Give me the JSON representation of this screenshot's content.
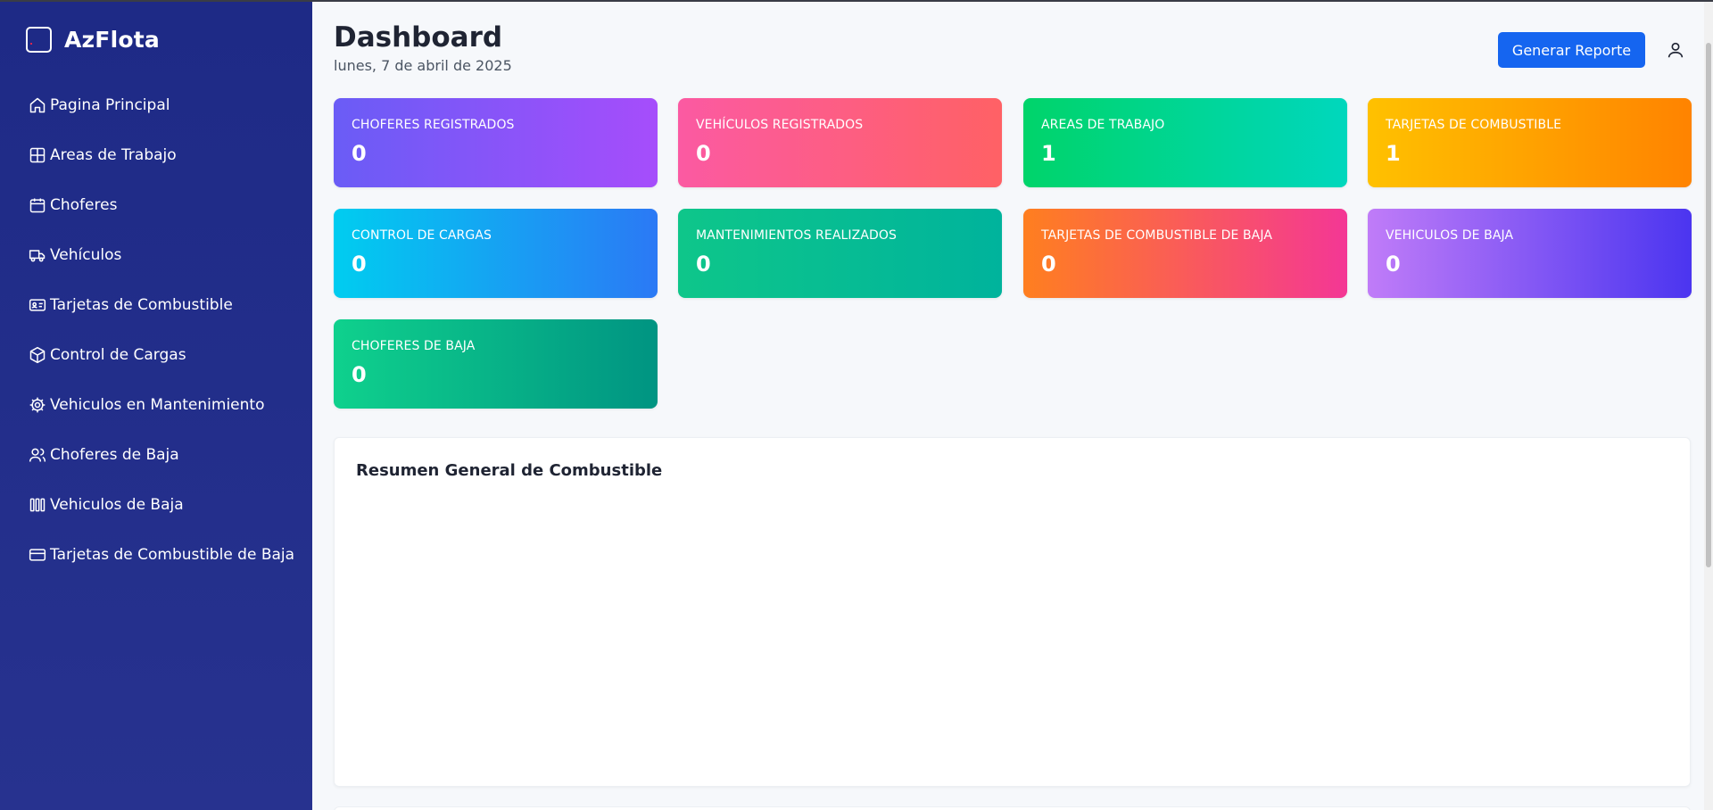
{
  "app": {
    "name": "AzFlota"
  },
  "sidebar": {
    "items": [
      {
        "label": "Pagina Principal",
        "icon": "home-icon"
      },
      {
        "label": "Areas de Trabajo",
        "icon": "grid-icon"
      },
      {
        "label": "Choferes",
        "icon": "calendar-icon"
      },
      {
        "label": "Vehículos",
        "icon": "truck-icon"
      },
      {
        "label": "Tarjetas de Combustible",
        "icon": "id-card-icon"
      },
      {
        "label": "Control de Cargas",
        "icon": "package-icon"
      },
      {
        "label": "Vehiculos en Mantenimiento",
        "icon": "gear-icon"
      },
      {
        "label": "Choferes de Baja",
        "icon": "users-icon"
      },
      {
        "label": "Vehiculos de Baja",
        "icon": "barrier-icon"
      },
      {
        "label": "Tarjetas de Combustible de Baja",
        "icon": "credit-card-icon"
      }
    ]
  },
  "header": {
    "title": "Dashboard",
    "date": "lunes, 7 de abril de 2025",
    "report_button": "Generar Reporte"
  },
  "cards": [
    {
      "label": "CHOFERES REGISTRADOS",
      "value": "0"
    },
    {
      "label": "VEHÍCULOS REGISTRADOS",
      "value": "0"
    },
    {
      "label": "AREAS DE TRABAJO",
      "value": "1"
    },
    {
      "label": "TARJETAS DE COMBUSTIBLE",
      "value": "1"
    },
    {
      "label": "CONTROL DE CARGAS",
      "value": "0"
    },
    {
      "label": "MANTENIMIENTOS REALIZADOS",
      "value": "0"
    },
    {
      "label": "TARJETAS DE COMBUSTIBLE DE BAJA",
      "value": "0"
    },
    {
      "label": "VEHICULOS DE BAJA",
      "value": "0"
    },
    {
      "label": "CHOFERES DE BAJA",
      "value": "0"
    }
  ],
  "panel": {
    "title": "Resumen General de Combustible"
  },
  "colors": {
    "sidebar": "#1e2a86",
    "accent": "#1565f0"
  }
}
